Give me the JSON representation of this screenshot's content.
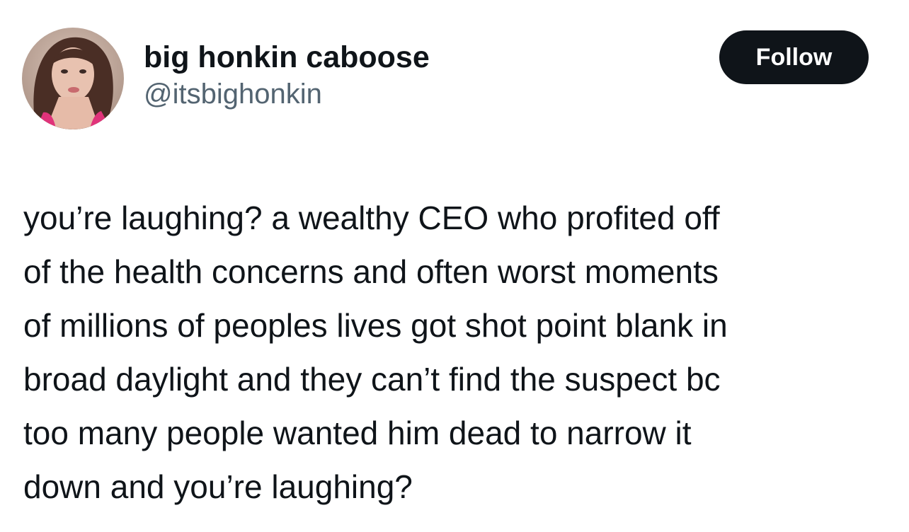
{
  "author": {
    "display_name": "big honkin caboose",
    "handle": "@itsbighonkin",
    "avatar_icon": "profile-photo"
  },
  "actions": {
    "follow_label": "Follow"
  },
  "tweet": {
    "lines": [
      "you’re laughing? a wealthy CEO who profited off",
      "of the health concerns and often worst moments",
      "of millions of peoples lives got shot point blank in",
      "broad daylight and they can’t find the suspect bc",
      "too many people wanted him dead to narrow it",
      "down and you’re laughing?"
    ]
  },
  "colors": {
    "text": "#0f1419",
    "handle": "#536471",
    "button_bg": "#0f1419",
    "button_text": "#ffffff",
    "background": "#ffffff"
  }
}
